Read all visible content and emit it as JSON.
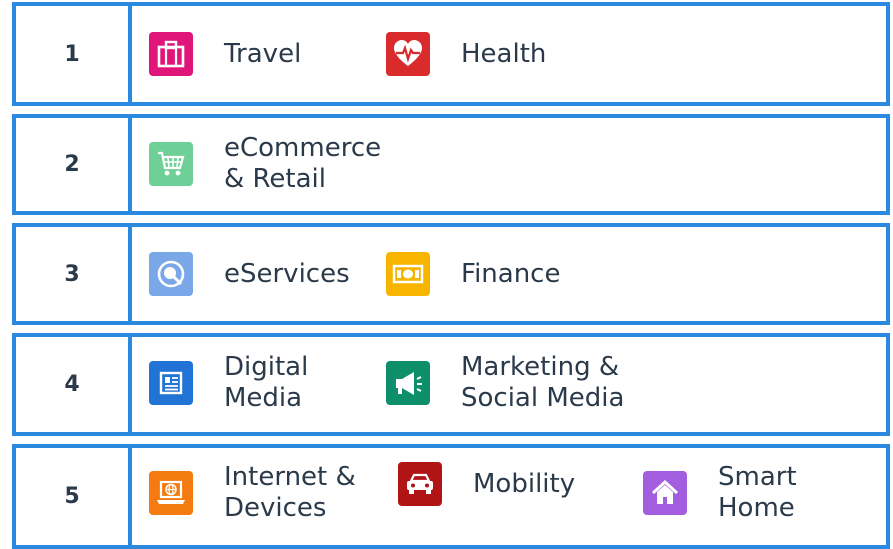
{
  "rows": [
    {
      "number": "1",
      "items": [
        {
          "label": "Travel",
          "icon": "suitcase-icon",
          "color": "#e0157a"
        },
        {
          "label": "Health",
          "icon": "heart-pulse-icon",
          "color": "#d92b2b"
        }
      ]
    },
    {
      "number": "2",
      "items": [
        {
          "label_line1": "eCommerce",
          "label_line2": "& Retail",
          "icon": "shopping-cart-icon",
          "color": "#6fd097"
        }
      ]
    },
    {
      "number": "3",
      "items": [
        {
          "label": "eServices",
          "icon": "eservices-icon",
          "color": "#7aa7e8"
        },
        {
          "label": "Finance",
          "icon": "banknote-icon",
          "color": "#f7b500"
        }
      ]
    },
    {
      "number": "4",
      "items": [
        {
          "label_line1": "Digital",
          "label_line2": "Media",
          "icon": "newspaper-icon",
          "color": "#2273d6"
        },
        {
          "label_line1": "Marketing &",
          "label_line2": "Social Media",
          "icon": "megaphone-icon",
          "color": "#0e8f6c"
        }
      ]
    },
    {
      "number": "5",
      "items": [
        {
          "label_line1": "Internet &",
          "label_line2": "Devices",
          "icon": "laptop-globe-icon",
          "color": "#f47b10"
        },
        {
          "label": "Mobility",
          "icon": "car-icon",
          "color": "#b01414"
        },
        {
          "label_line1": "Smart",
          "label_line2": "Home",
          "icon": "house-icon",
          "color": "#a35ee0"
        }
      ]
    }
  ],
  "border_color": "#2b8ae0"
}
